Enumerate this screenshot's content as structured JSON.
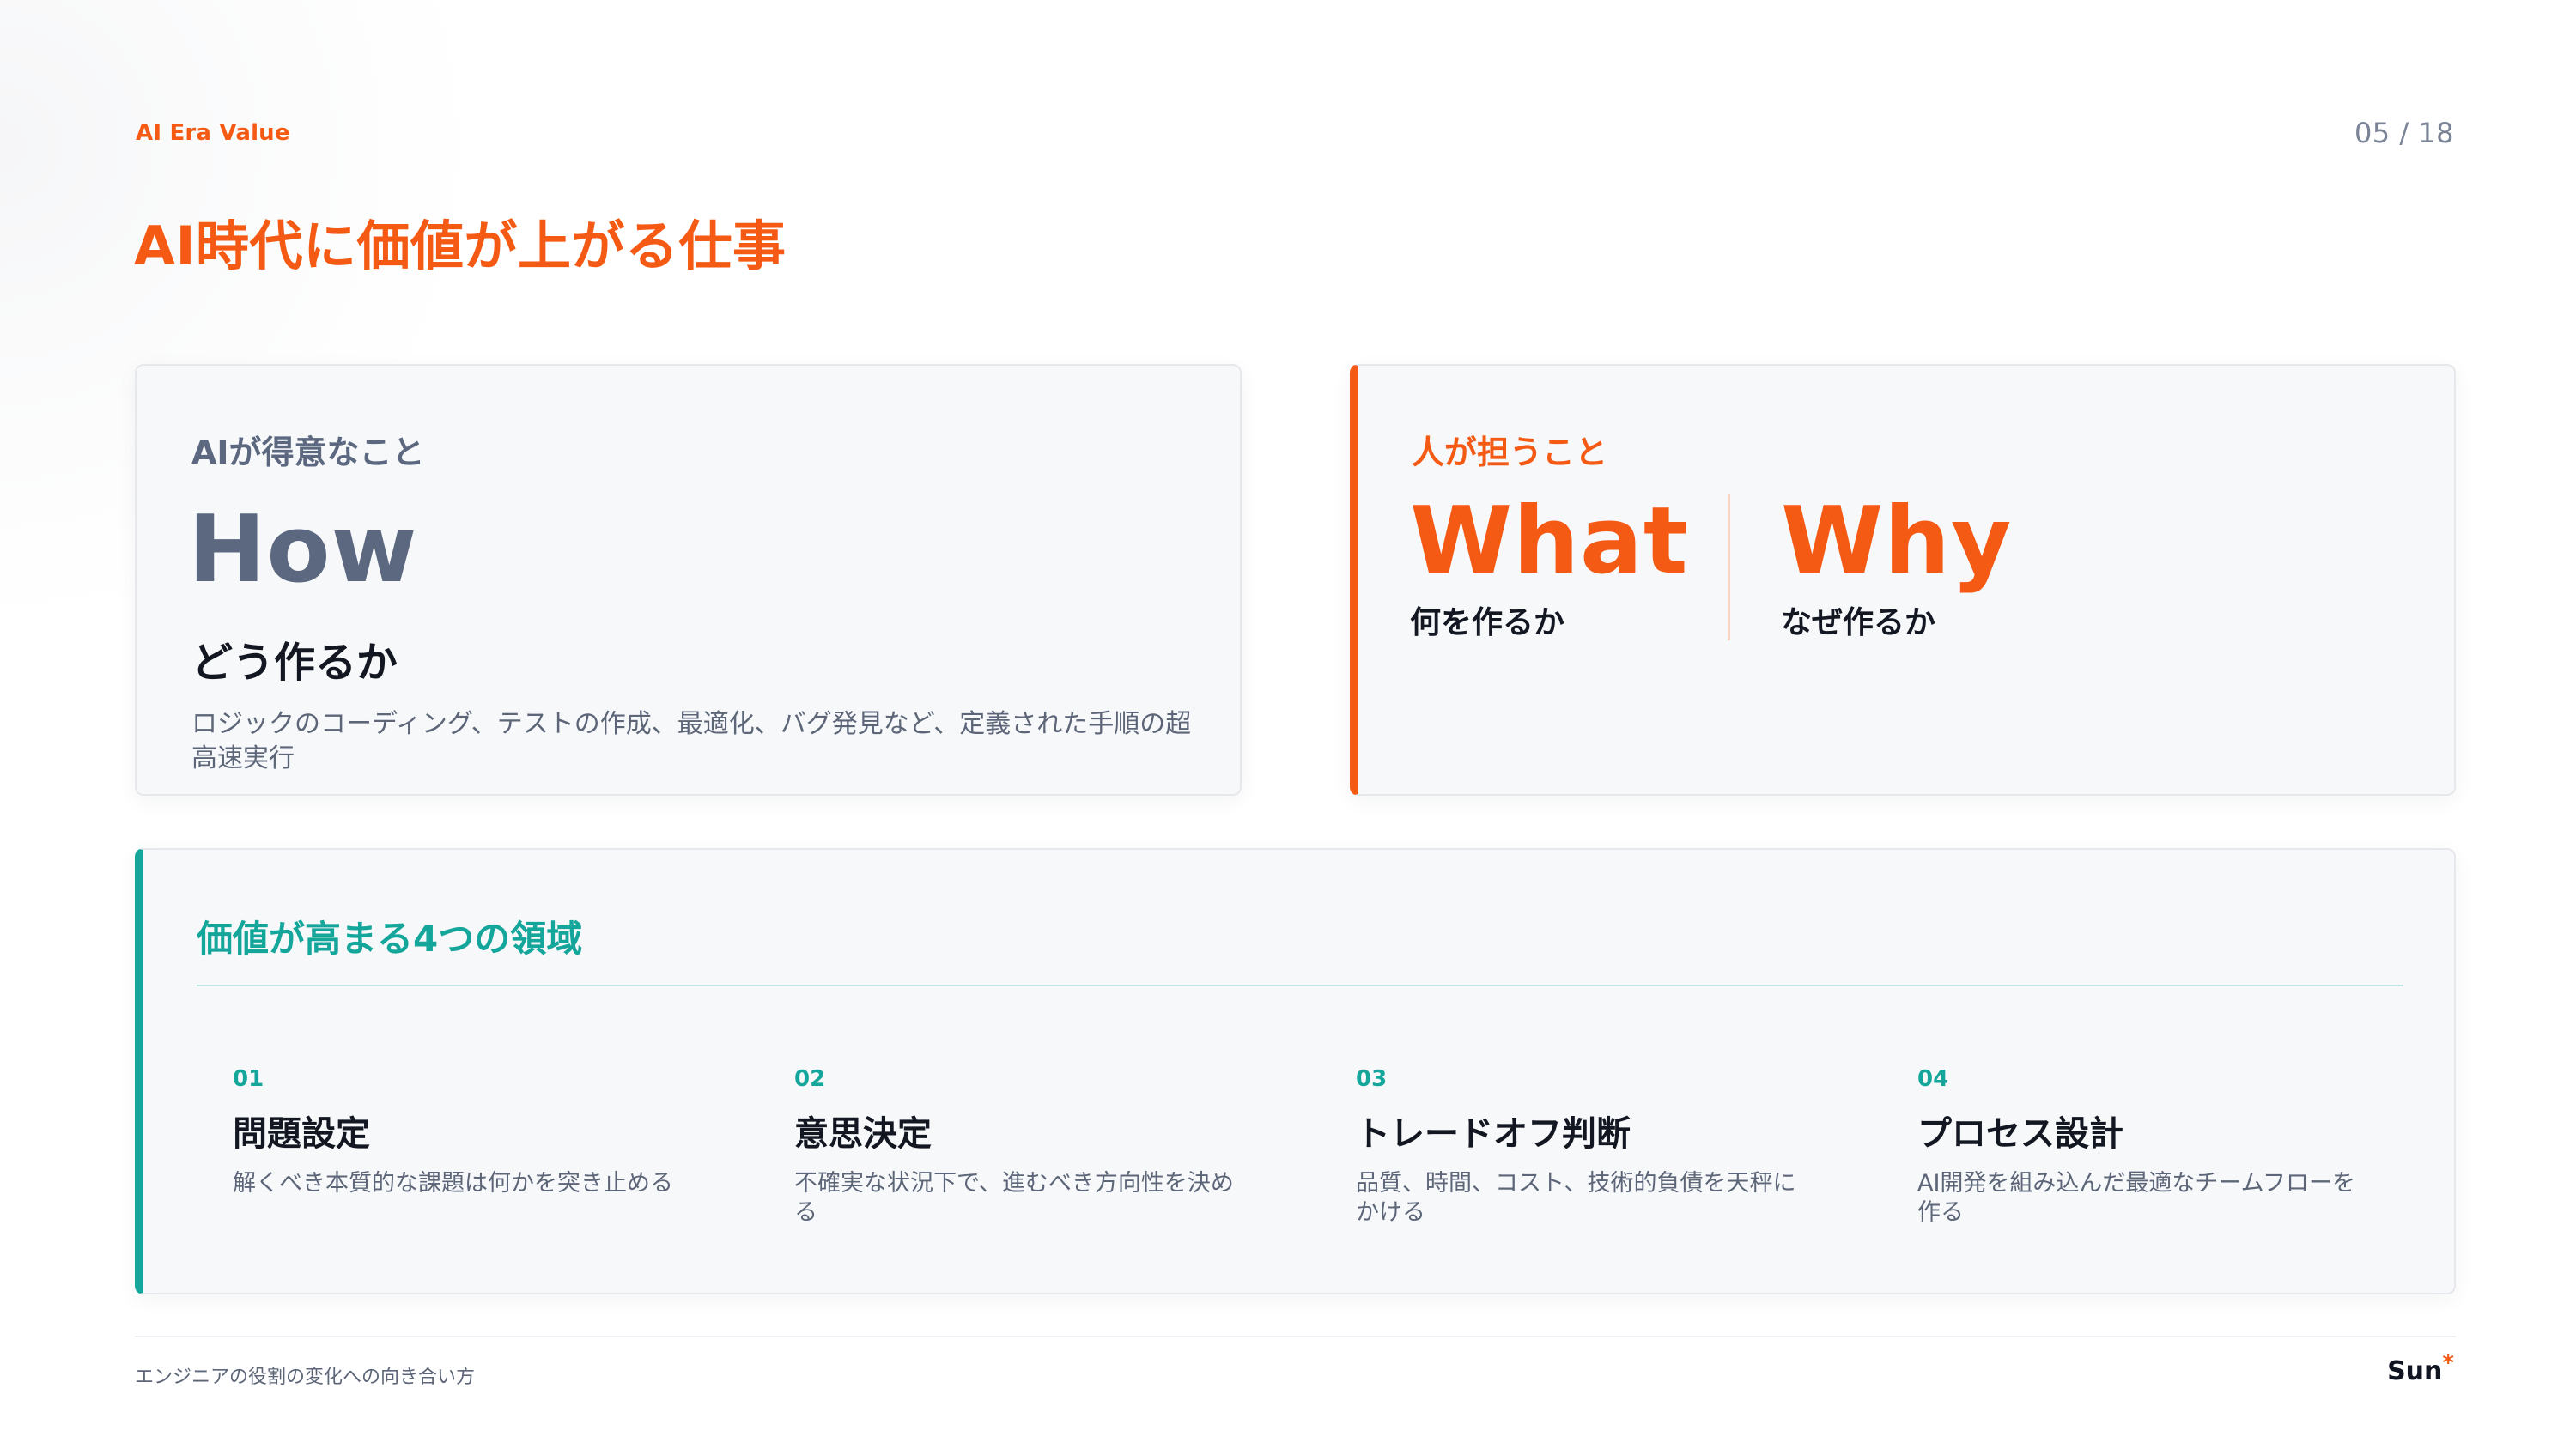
{
  "header": {
    "eyebrow": "AI Era Value",
    "page_number": "05 / 18",
    "title": "AI時代に価値が上がる仕事"
  },
  "ai_card": {
    "label": "AIが得意なこと",
    "keyword": "How",
    "subtitle": "どう作るか",
    "description": "ロジックのコーディング、テストの作成、最適化、バグ発見など、定義された手順の超高速実行"
  },
  "human_card": {
    "label": "人が担うこと",
    "items": [
      {
        "keyword": "What",
        "caption": "何を作るか"
      },
      {
        "keyword": "Why",
        "caption": "なぜ作るか"
      }
    ]
  },
  "areas": {
    "title": "価値が高まる4つの領域",
    "items": [
      {
        "number": "01",
        "title": "問題設定",
        "description": "解くべき本質的な課題は何かを突き止める"
      },
      {
        "number": "02",
        "title": "意思決定",
        "description": "不確実な状況下で、進むべき方向性を決める"
      },
      {
        "number": "03",
        "title": "トレードオフ判断",
        "description": "品質、時間、コスト、技術的負債を天秤にかける"
      },
      {
        "number": "04",
        "title": "プロセス設計",
        "description": "AI開発を組み込んだ最適なチームフローを作る"
      }
    ]
  },
  "footer": {
    "text": "エンジニアの役割の変化への向き合い方",
    "brand": "Sun",
    "brand_mark": "*"
  },
  "colors": {
    "accent_orange": "#f55a14",
    "accent_teal": "#14a69a",
    "muted_slate": "#5c6880"
  }
}
